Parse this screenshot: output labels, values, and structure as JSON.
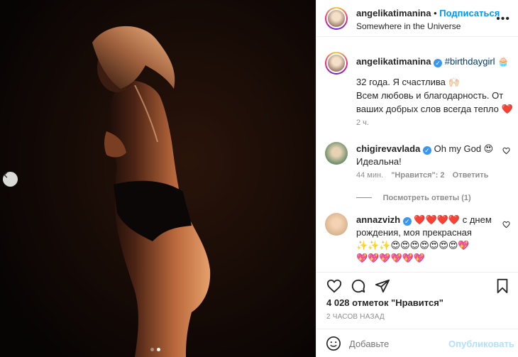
{
  "post": {
    "author": "angelikatimanina",
    "follow_label": "Подписаться",
    "location": "Somewhere in the Universe",
    "more_icon": "ellipsis-icon",
    "photo": {
      "dots": 2,
      "active_dot": 2
    }
  },
  "caption": {
    "author": "angelikatimanina",
    "hashtag": "#birthdaygirl",
    "emoji_after_tag": "🧁",
    "line1": "32 года. Я счастлива 🙌🏻",
    "line2": "Всем любовь и благодарность. От",
    "line3": "ваших добрых слов всегда тепло ❤️",
    "time": "2 ч."
  },
  "comments": [
    {
      "author": "chigirevavlada",
      "text_line1": "Oh my God 😍",
      "text_line2": "Идеальна!",
      "time": "44 мин.",
      "likes": "\"Нравится\": 2",
      "reply": "Ответить",
      "view_replies": "Посмотреть ответы (1)"
    },
    {
      "author": "annazvizh",
      "text_line1": "❤️❤️❤️❤️ с днем",
      "text_line2": "рождения, моя прекрасная",
      "text_line3": "✨✨✨😍😍😍😍😍😍😍💖",
      "text_line4": "💖💖💖💖💖💖"
    }
  ],
  "actions": {
    "likes_count": "4 028 отметок \"Нравится\"",
    "posted_ago": "2 ЧАСОВ НАЗАД",
    "comment_placeholder": "Добавьте",
    "publish_label": "Опубликовать"
  }
}
